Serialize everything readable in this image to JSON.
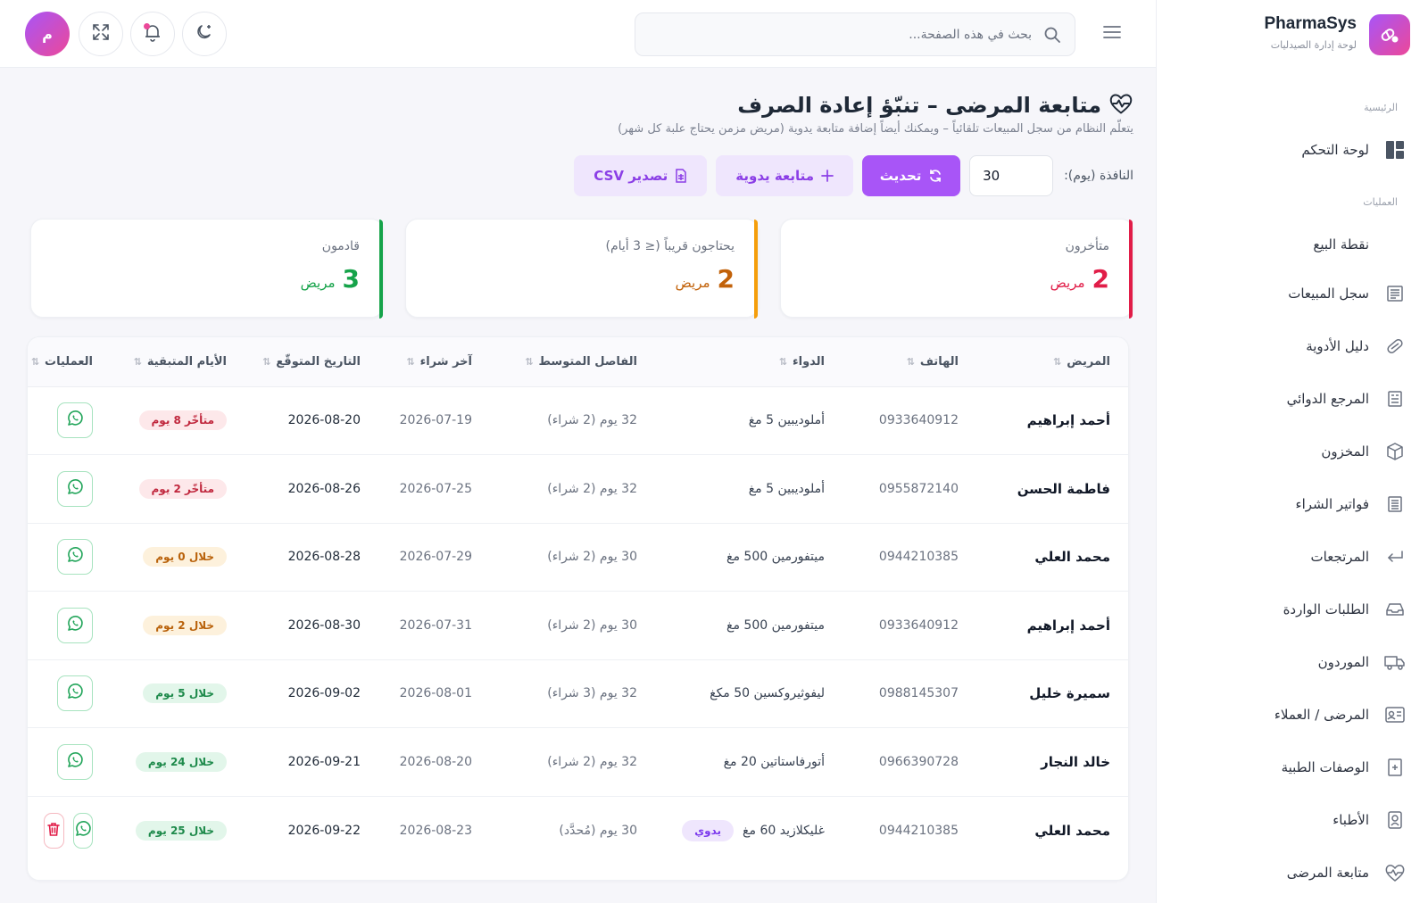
{
  "brand": {
    "name": "PharmaSys",
    "subtitle": "لوحة إدارة الصيدليات"
  },
  "sidebar": {
    "section_main": "الرئيسية",
    "section_ops": "العمليات",
    "items": [
      {
        "label": "لوحة التحكم",
        "icon": "dashboard-icon"
      },
      {
        "label": "نقطة البيع",
        "icon": ""
      },
      {
        "label": "سجل المبيعات",
        "icon": "receipt-icon"
      },
      {
        "label": "دليل الأدوية",
        "icon": "pill-icon"
      },
      {
        "label": "المرجع الدوائي",
        "icon": "reference-icon"
      },
      {
        "label": "المخزون",
        "icon": "box-icon"
      },
      {
        "label": "فواتير الشراء",
        "icon": "invoice-icon"
      },
      {
        "label": "المرتجعات",
        "icon": "return-icon"
      },
      {
        "label": "الطلبات الواردة",
        "icon": "inbox-icon"
      },
      {
        "label": "الموردون",
        "icon": "truck-icon"
      },
      {
        "label": "المرضى / العملاء",
        "icon": "id-card-icon"
      },
      {
        "label": "الوصفات الطبية",
        "icon": "prescription-icon"
      },
      {
        "label": "الأطباء",
        "icon": "doctor-icon"
      },
      {
        "label": "متابعة المرضى",
        "icon": "heartbeat-icon"
      }
    ]
  },
  "header": {
    "search_placeholder": "بحث في هذه الصفحة...",
    "avatar_initial": "م"
  },
  "page": {
    "title": "متابعة المرضى – تنبّؤ إعادة الصرف",
    "subtitle": "يتعلّم النظام من سجل المبيعات تلقائياً – ويمكنك أيضاً إضافة متابعة يدوية (مريض مزمن يحتاج علبة كل شهر)"
  },
  "toolbar": {
    "window_label": "النافذة (يوم):",
    "window_value": "30",
    "refresh_label": "تحديث",
    "manual_label": "متابعة يدوية",
    "export_label": "تصدير CSV"
  },
  "stats": [
    {
      "label": "متأخرون",
      "value": "2",
      "unit": "مريض",
      "color": "#e11d48"
    },
    {
      "label": "يحتاجون قريباً (≤ 3 أيام)",
      "value": "2",
      "unit": "مريض",
      "color": "#c2620a"
    },
    {
      "label": "قادمون",
      "value": "3",
      "unit": "مريض",
      "color": "#16a34a"
    }
  ],
  "table": {
    "columns": [
      "المريض",
      "الهاتف",
      "الدواء",
      "الفاصل المتوسط",
      "آخر شراء",
      "التاريخ المتوقّع",
      "الأيام المتبقية",
      "العمليات"
    ],
    "rows": [
      {
        "patient": "أحمد إبراهيم",
        "phone": "0933640912",
        "drug": "أملوديبين 5 مغ",
        "manual": "",
        "interval": "32 يوم (2 شراء)",
        "last": "2026-07-19",
        "expected": "2026-08-20",
        "remaining": "متأخّر 8 يوم",
        "status": "red",
        "deletable": false
      },
      {
        "patient": "فاطمة الحسن",
        "phone": "0955872140",
        "drug": "أملوديبين 5 مغ",
        "manual": "",
        "interval": "32 يوم (2 شراء)",
        "last": "2026-07-25",
        "expected": "2026-08-26",
        "remaining": "متأخّر 2 يوم",
        "status": "red",
        "deletable": false
      },
      {
        "patient": "محمد العلي",
        "phone": "0944210385",
        "drug": "ميتفورمين 500 مغ",
        "manual": "",
        "interval": "30 يوم (2 شراء)",
        "last": "2026-07-29",
        "expected": "2026-08-28",
        "remaining": "خلال 0 يوم",
        "status": "amber",
        "deletable": false
      },
      {
        "patient": "أحمد إبراهيم",
        "phone": "0933640912",
        "drug": "ميتفورمين 500 مغ",
        "manual": "",
        "interval": "30 يوم (2 شراء)",
        "last": "2026-07-31",
        "expected": "2026-08-30",
        "remaining": "خلال 2 يوم",
        "status": "amber",
        "deletable": false
      },
      {
        "patient": "سميرة خليل",
        "phone": "0988145307",
        "drug": "ليفوثيروكسين 50 مكغ",
        "manual": "",
        "interval": "32 يوم (3 شراء)",
        "last": "2026-08-01",
        "expected": "2026-09-02",
        "remaining": "خلال 5 يوم",
        "status": "green",
        "deletable": false
      },
      {
        "patient": "خالد النجار",
        "phone": "0966390728",
        "drug": "أتورفاستاتين 20 مغ",
        "manual": "",
        "interval": "32 يوم (2 شراء)",
        "last": "2026-08-20",
        "expected": "2026-09-21",
        "remaining": "خلال 24 يوم",
        "status": "green",
        "deletable": false
      },
      {
        "patient": "محمد العلي",
        "phone": "0944210385",
        "drug": "غليكلازيد 60 مغ",
        "manual": "يدوي",
        "interval": "30 يوم (مُحدَّد)",
        "last": "2026-08-23",
        "expected": "2026-09-22",
        "remaining": "خلال 25 يوم",
        "status": "green",
        "deletable": true
      }
    ]
  }
}
